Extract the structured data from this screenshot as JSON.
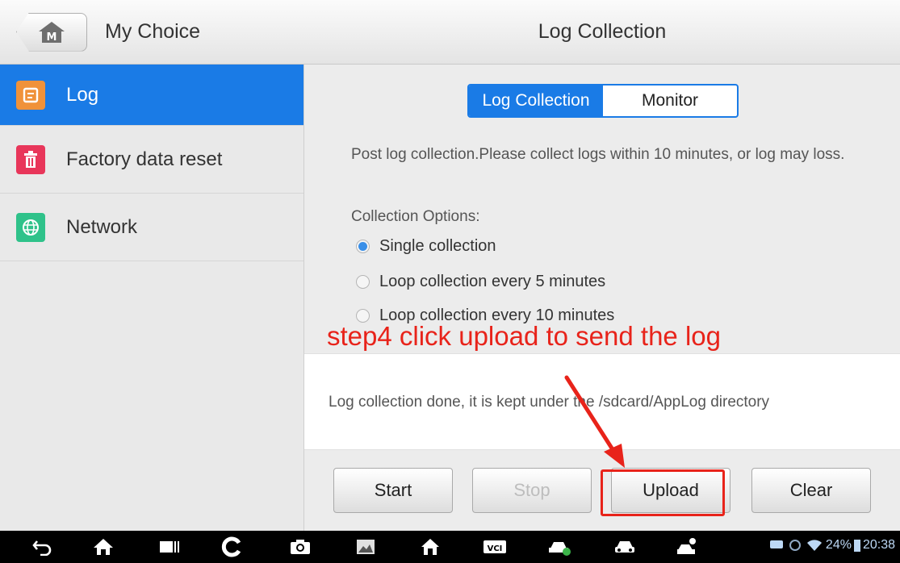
{
  "left_header": {
    "title": "My Choice",
    "home_icon_letter": "M"
  },
  "sidebar": {
    "items": [
      {
        "label": "Log",
        "icon": "log-icon",
        "color": "#f0923a",
        "active": true
      },
      {
        "label": "Factory data reset",
        "icon": "trash-icon",
        "color": "#e8365a",
        "active": false
      },
      {
        "label": "Network",
        "icon": "globe-icon",
        "color": "#2fc28a",
        "active": false
      }
    ]
  },
  "right_header": {
    "title": "Log Collection"
  },
  "tabs": {
    "selected": "Log Collection",
    "other": "Monitor"
  },
  "main": {
    "description": "Post log collection.Please collect logs within 10 minutes, or log may loss.",
    "options_label": "Collection Options:",
    "options": [
      {
        "label": "Single collection",
        "selected": true
      },
      {
        "label": "Loop collection every 5 minutes",
        "selected": false
      },
      {
        "label": "Loop collection every 10 minutes",
        "selected": false
      }
    ],
    "result": "Log collection done, it is kept under the /sdcard/AppLog directory"
  },
  "annotation": {
    "text": "step4 click upload to send the log",
    "color": "#e8231a"
  },
  "buttons": {
    "start": "Start",
    "stop": "Stop",
    "upload": "Upload",
    "clear": "Clear"
  },
  "status_bar": {
    "battery": "24%",
    "time": "20:38"
  },
  "colors": {
    "accent": "#1a7be6"
  }
}
